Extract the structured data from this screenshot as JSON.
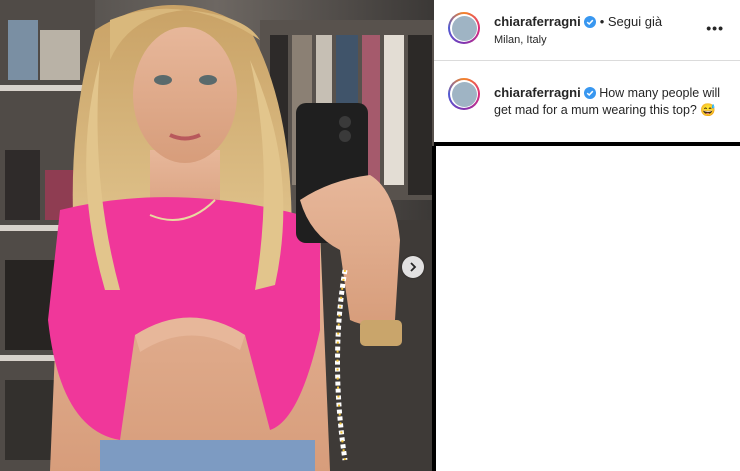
{
  "post": {
    "username": "chiaraferragni",
    "follow_label": "• Segui già",
    "location": "Milan, Italy",
    "more_label": "•••",
    "caption_username": "chiaraferragni",
    "caption_text": "How many people will get mad for a mum wearing this top?",
    "caption_emoji": "😅"
  },
  "icons": {
    "verified": "verified-badge-icon",
    "next": "chevron-right-icon"
  },
  "colors": {
    "verified_blue": "#3897f0",
    "top_pink": "#f0379a",
    "text": "#262626"
  }
}
